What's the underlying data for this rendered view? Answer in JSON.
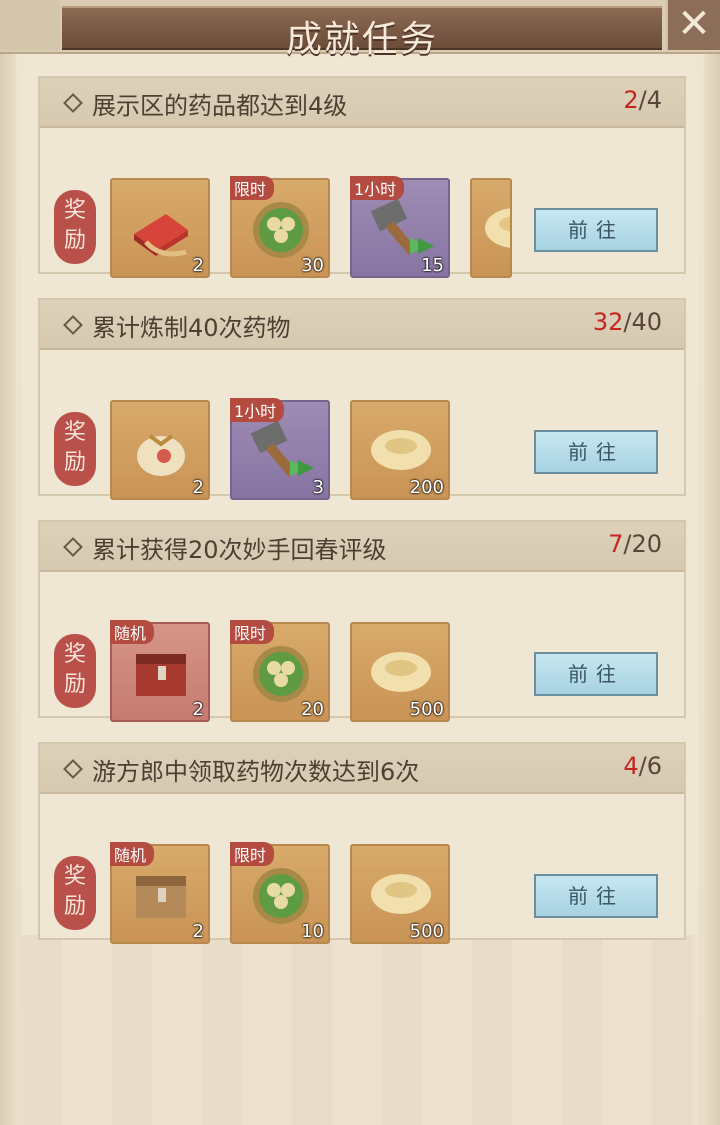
{
  "header": {
    "title": "成就任务",
    "close_icon": "close-icon"
  },
  "tasks": [
    {
      "title": "展示区的药品都达到4级",
      "progress_current": "2",
      "progress_total": "/4",
      "reward_label": "奖励",
      "button": "前往",
      "items": [
        {
          "icon": "red-gift-box-icon",
          "count": "2",
          "tag": ""
        },
        {
          "icon": "clover-coin-icon",
          "count": "30",
          "tag": "限时"
        },
        {
          "icon": "hammer-speedup-icon",
          "count": "15",
          "tag": "1小时"
        },
        {
          "icon": "gold-ingot-icon",
          "count": "",
          "tag": ""
        }
      ]
    },
    {
      "title": "累计炼制40次药物",
      "progress_current": "32",
      "progress_total": "/40",
      "reward_label": "奖励",
      "button": "前往",
      "items": [
        {
          "icon": "seed-pouch-icon",
          "count": "2",
          "tag": ""
        },
        {
          "icon": "hammer-speedup-icon",
          "count": "3",
          "tag": "1小时"
        },
        {
          "icon": "gold-ingot-icon",
          "count": "200",
          "tag": ""
        }
      ]
    },
    {
      "title": "累计获得20次妙手回春评级",
      "progress_current": "7",
      "progress_total": "/20",
      "reward_label": "奖励",
      "button": "前往",
      "items": [
        {
          "icon": "random-red-chest-icon",
          "count": "2",
          "tag": "随机"
        },
        {
          "icon": "clover-coin-icon",
          "count": "20",
          "tag": "限时"
        },
        {
          "icon": "gold-ingot-icon",
          "count": "500",
          "tag": ""
        }
      ]
    },
    {
      "title": "游方郎中领取药物次数达到6次",
      "progress_current": "4",
      "progress_total": "/6",
      "reward_label": "奖励",
      "button": "前往",
      "items": [
        {
          "icon": "random-wood-chest-icon",
          "count": "2",
          "tag": "随机"
        },
        {
          "icon": "clover-coin-icon",
          "count": "10",
          "tag": "限时"
        },
        {
          "icon": "gold-ingot-icon",
          "count": "500",
          "tag": ""
        }
      ]
    }
  ]
}
